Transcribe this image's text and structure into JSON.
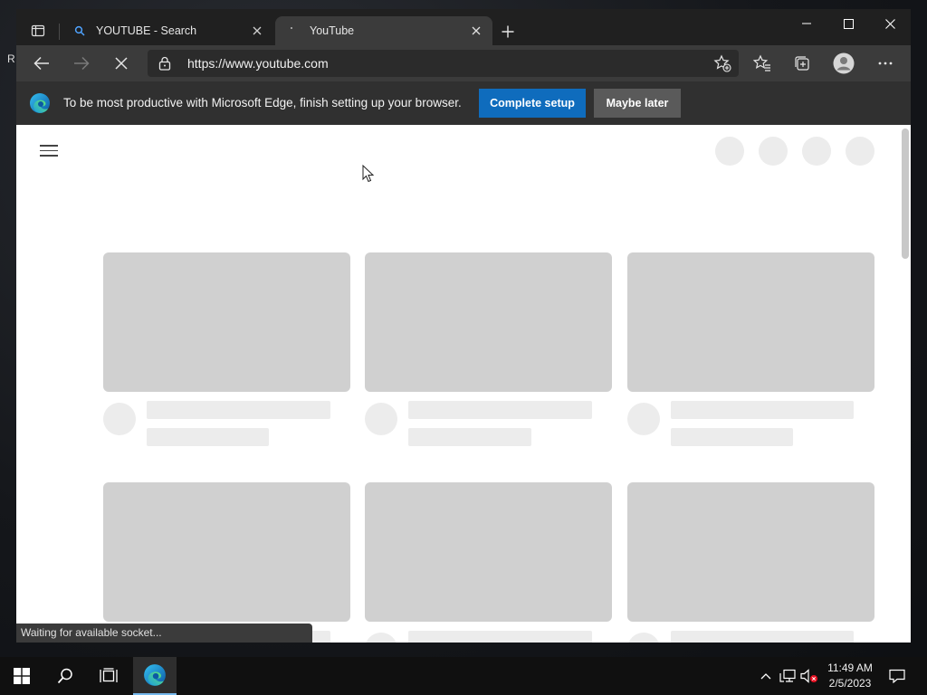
{
  "desktop": {
    "peek_text": "R"
  },
  "tabs": [
    {
      "title": "YOUTUBE - Search",
      "icon": "search-icon"
    },
    {
      "title": "YouTube",
      "icon": "loading-icon",
      "active": true
    }
  ],
  "toolbar": {
    "url": "https://www.youtube.com"
  },
  "infobar": {
    "message": "To be most productive with Microsoft Edge, finish setting up your browser.",
    "primary_label": "Complete setup",
    "secondary_label": "Maybe later"
  },
  "status": {
    "text": "Waiting for available socket..."
  },
  "taskbar": {
    "time": "11:49 AM",
    "date": "2/5/2023"
  },
  "colors": {
    "accent": "#0f6cbd",
    "placeholder_dark": "#d0d0d0",
    "placeholder_light": "#ececec"
  }
}
